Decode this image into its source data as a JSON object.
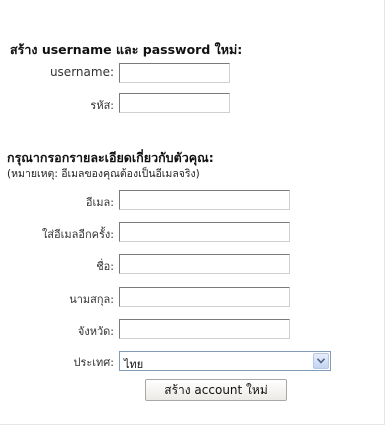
{
  "account_section": {
    "heading": "สร้าง username และ password ใหม่:",
    "username_label": "username:",
    "password_label": "รหัส:",
    "username_value": "",
    "password_value": ""
  },
  "details_section": {
    "heading": "กรุณากรอกรายละเอียดเกี่ยวกับตัวคุณ:",
    "note": "(หมายเหตุ: อีเมลของคุณต้องเป็นอีเมลจริง)",
    "email_label": "อีเมล:",
    "email_confirm_label": "ใส่อีเมลอีกครั้ง:",
    "first_name_label": "ชื่อ:",
    "last_name_label": "นามสกุล:",
    "city_label": "จังหวัด:",
    "country_label": "ประเทศ:",
    "email_value": "",
    "email_confirm_value": "",
    "first_name_value": "",
    "last_name_value": "",
    "city_value": "",
    "country_value": "ไทย",
    "dropdown_icon": "chevron-down-icon"
  },
  "submit_button_label": "สร้าง account ใหม่"
}
